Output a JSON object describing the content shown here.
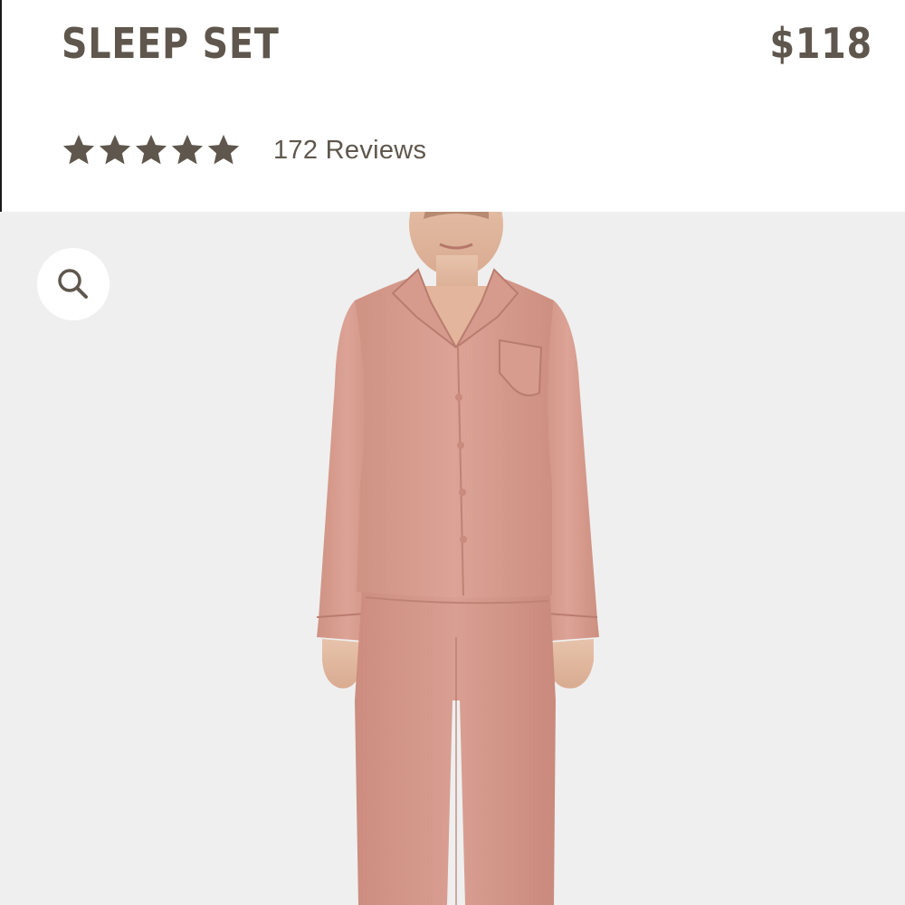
{
  "product": {
    "title": "SLEEP SET",
    "price": "$118"
  },
  "rating": {
    "stars_filled": 5,
    "stars_total": 5,
    "reviews_label": "172 Reviews"
  },
  "icons": {
    "star": "star-icon",
    "zoom": "search-icon"
  },
  "colors": {
    "text": "#5f574d",
    "star": "#5f574d",
    "image_background": "#efefef",
    "garment": "#d79a8c"
  }
}
